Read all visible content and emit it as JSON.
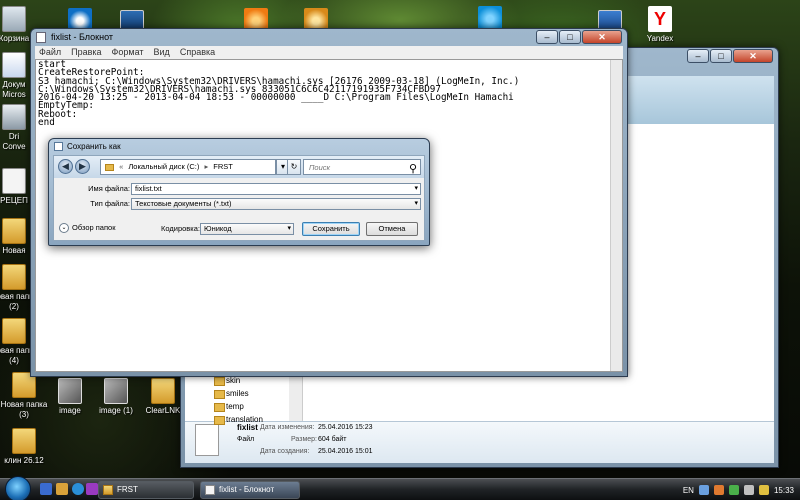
{
  "desktop": {
    "icons_left": [
      {
        "label": "Корзина",
        "kind": "recycle-bin-icon"
      },
      {
        "label": "Докум",
        "sub": "Micros",
        "kind": "word-document-icon"
      },
      {
        "label": "Dri",
        "sub": "Conve",
        "kind": "converter-icon"
      },
      {
        "label": "РЕЦЕП",
        "kind": "document-icon"
      },
      {
        "label": "Новая",
        "kind": "folder-icon"
      },
      {
        "label": "Новая папка",
        "sub": "(2)",
        "kind": "folder-icon"
      },
      {
        "label": "Новая папка",
        "sub": "(4)",
        "kind": "folder-icon"
      },
      {
        "label": "Новая папка",
        "sub": "(3)",
        "kind": "folder-icon"
      },
      {
        "label": "клин 26.12",
        "kind": "folder-icon"
      }
    ],
    "icons_bottom": [
      {
        "label": "image",
        "kind": "image-icon"
      },
      {
        "label": "image (1)",
        "kind": "image-icon"
      },
      {
        "label": "ClearLNK",
        "kind": "folder-icon"
      }
    ],
    "yandex_label": "Yandex"
  },
  "notepad": {
    "title": "fixlist - Блокнот",
    "menu": [
      "Файл",
      "Правка",
      "Формат",
      "Вид",
      "Справка"
    ],
    "content": "start\nCreateRestorePoint:\nS3 hamachi; C:\\Windows\\System32\\DRIVERS\\hamachi.sys [26176 2009-03-18] (LogMeIn, Inc.)\nC:\\Windows\\System32\\DRIVERS\\hamachi.sys 833051C6C6C42117191935F734CFBD97\n2016-04-20 13:25 - 2013-04-04 18:53 - 00000000 ____D C:\\Program Files\\LogMeIn Hamachi\nEmptyTemp:\nReboot:\nend"
  },
  "explorer": {
    "tree": [
      "skin",
      "smiles",
      "temp",
      "translation"
    ],
    "details": {
      "name": "fixlist",
      "type": "Файл",
      "modified_label": "Дата изменения:",
      "modified": "25.04.2016 15:23",
      "size_label": "Размер:",
      "size": "604 байт",
      "created_label": "Дата создания:",
      "created": "25.04.2016 15:01"
    }
  },
  "save_dialog": {
    "title": "Сохранить как",
    "path": [
      "Локальный диск (C:)",
      "FRST"
    ],
    "search_placeholder": "Поиск",
    "filename_label": "Имя файла:",
    "filename": "fixlist.txt",
    "filetype_label": "Тип файла:",
    "filetype": "Текстовые документы (*.txt)",
    "browse_label": "Обзор папок",
    "encoding_label": "Кодировка:",
    "encoding": "Юникод",
    "save_label": "Сохранить",
    "cancel_label": "Отмена"
  },
  "taskbar": {
    "tasks": [
      {
        "label": "FRST"
      },
      {
        "label": "fixlist - Блокнот"
      }
    ],
    "lang": "EN",
    "time": "15:33"
  },
  "colors": {
    "accent": "#3c7fb1",
    "title_glass": "#9fb7cc"
  }
}
